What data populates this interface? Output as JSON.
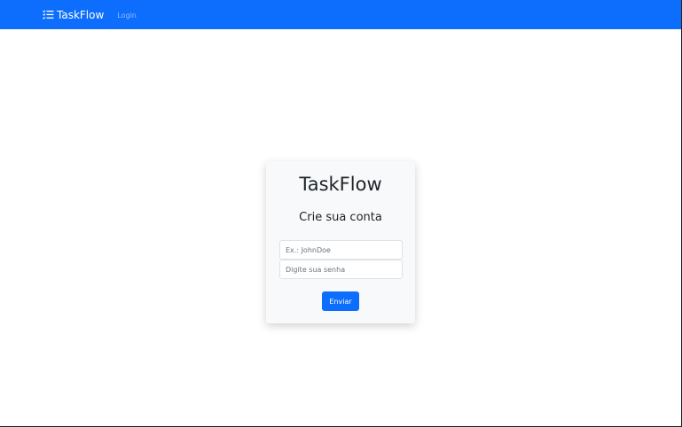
{
  "navbar": {
    "brand_label": "TaskFlow",
    "brand_icon": "list-check-icon",
    "login_link": "Login",
    "color": "#0d6efd"
  },
  "card": {
    "title": "TaskFlow",
    "subtitle": "Crie sua conta",
    "username_placeholder": "Ex.: JohnDoe",
    "username_value": "",
    "password_placeholder": "Digite sua senha",
    "password_value": "",
    "submit_label": "Enviar"
  }
}
